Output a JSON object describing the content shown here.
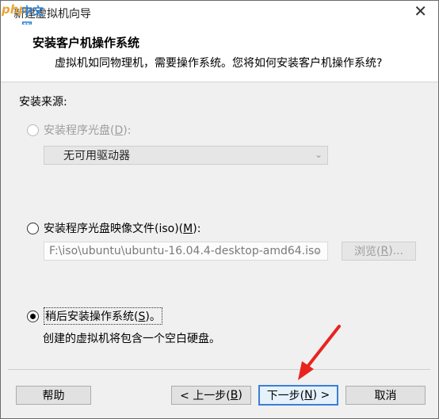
{
  "window": {
    "title": "新建虚拟机向导",
    "watermark": {
      "php": "php",
      "cn": "中文网"
    },
    "close_glyph": "✕"
  },
  "header": {
    "title": "安装客户机操作系统",
    "subtitle": "虚拟机如同物理机，需要操作系统。您将如何安装客户机操作系统?"
  },
  "install_source": {
    "label": "安装来源:",
    "options": [
      {
        "label_pre": "安装程序光盘(",
        "key": "D",
        "label_post": "):",
        "selected": false,
        "disabled": true
      },
      {
        "label_pre": "安装程序光盘映像文件(iso)(",
        "key": "M",
        "label_post": "):",
        "selected": false,
        "disabled": false
      },
      {
        "label_pre": "稍后安装操作系统(",
        "key": "S",
        "label_post": ")。",
        "selected": true,
        "disabled": false
      }
    ],
    "drive_select": {
      "value": "无可用驱动器",
      "disabled": true
    },
    "iso_path": {
      "value": "F:\\iso\\ubuntu\\ubuntu-16.04.4-desktop-amd64.iso",
      "disabled": true
    },
    "browse_button": {
      "label_pre": "浏览(",
      "key": "R",
      "label_post": ")...",
      "disabled": true
    },
    "later_description": "创建的虚拟机将包含一个空白硬盘。"
  },
  "footer": {
    "help": "帮助",
    "back": {
      "label_pre": "< 上一步(",
      "key": "B",
      "label_post": ")"
    },
    "next": {
      "label_pre": "下一步(",
      "key": "N",
      "label_post": ") >"
    },
    "cancel": "取消"
  },
  "colors": {
    "annotation_arrow": "#e8231f",
    "primary_border": "#3b7fd4"
  }
}
